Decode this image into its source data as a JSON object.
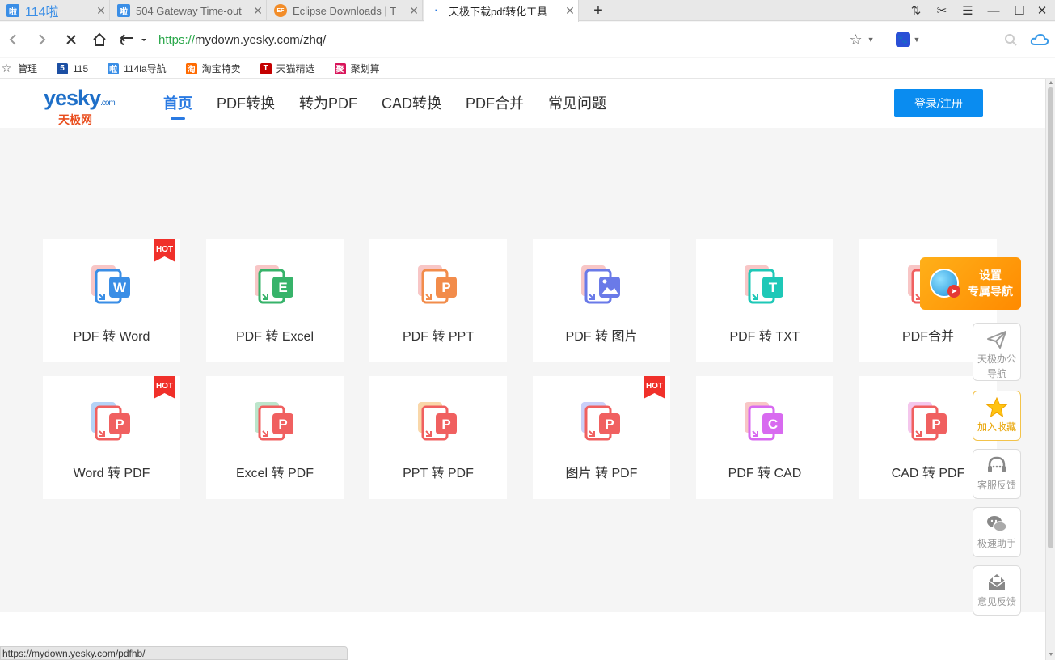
{
  "browser": {
    "tabs": [
      {
        "title": "114啦",
        "icon_text": "啦",
        "icon_color": "#3a8ee6"
      },
      {
        "title": "504 Gateway Time-out",
        "icon_text": "啦",
        "icon_color": "#3a8ee6"
      },
      {
        "title": "Eclipse Downloads | T",
        "icon_text": "EF",
        "icon_color": "#f28c28"
      },
      {
        "title": "天极下载pdf转化工具",
        "icon_text": "·",
        "icon_color": "#2a7ae2",
        "active": true
      }
    ],
    "new_tab": "+",
    "url_scheme": "https://",
    "url_rest": "mydown.yesky.com/zhq/",
    "bookmarks": [
      {
        "label": "管理",
        "icon": "star-outline",
        "icon_color": "#666"
      },
      {
        "label": "115",
        "icon_text": "5",
        "icon_color": "#1c4fa3"
      },
      {
        "label": "114la导航",
        "icon_text": "啦",
        "icon_color": "#3a8ee6"
      },
      {
        "label": "淘宝特卖",
        "icon_text": "淘",
        "icon_color": "#ff6a00"
      },
      {
        "label": "天猫精选",
        "icon_text": "T",
        "icon_color": "#c40000"
      },
      {
        "label": "聚划算",
        "icon_text": "聚",
        "icon_color": "#d8145a"
      }
    ],
    "status_url": "https://mydown.yesky.com/pdfhb/"
  },
  "site": {
    "logo_top": "yesky",
    "logo_com": ".com",
    "logo_bottom": "天极网",
    "nav": [
      "首页",
      "PDF转换",
      "转为PDF",
      "CAD转换",
      "PDF合并",
      "常见问题"
    ],
    "login": "登录/注册",
    "hot_badge": "HOT"
  },
  "tools": [
    {
      "label": "PDF 转 Word",
      "letter": "W",
      "color": "#3a8ee6",
      "back": "#f6b3b3",
      "hot": true
    },
    {
      "label": "PDF 转 Excel",
      "letter": "E",
      "color": "#37b36a",
      "back": "#f6b3b3",
      "hot": false
    },
    {
      "label": "PDF 转 PPT",
      "letter": "P",
      "color": "#f28c4b",
      "back": "#f6b3b3",
      "hot": false
    },
    {
      "label": "PDF 转 图片",
      "letter": "img",
      "color": "#6a7ae8",
      "back": "#f6b3b3",
      "hot": false
    },
    {
      "label": "PDF 转 TXT",
      "letter": "T",
      "color": "#1ec8b7",
      "back": "#f6b3b3",
      "hot": false
    },
    {
      "label": "PDF合并",
      "letter": "P",
      "color": "#f06060",
      "back": "#f6b3b3",
      "hot": false
    },
    {
      "label": "Word 转 PDF",
      "letter": "P",
      "color": "#f06060",
      "back": "#9cc3f3",
      "hot": true
    },
    {
      "label": "Excel 转 PDF",
      "letter": "P",
      "color": "#f06060",
      "back": "#a6dcb9",
      "hot": false
    },
    {
      "label": "PPT 转 PDF",
      "letter": "P",
      "color": "#f06060",
      "back": "#f7c98c",
      "hot": false
    },
    {
      "label": "图片 转 PDF",
      "letter": "P",
      "color": "#f06060",
      "back": "#b8bff5",
      "hot": true
    },
    {
      "label": "PDF 转 CAD",
      "letter": "C",
      "color": "#d86af0",
      "back": "#f6b3b3",
      "hot": false
    },
    {
      "label": "CAD 转 PDF",
      "letter": "P",
      "color": "#f06060",
      "back": "#f0b3e6",
      "hot": false
    }
  ],
  "side": {
    "promo_line1": "设置",
    "promo_line2": "专属导航",
    "buttons": [
      {
        "line1": "天极办公",
        "line2": "导航",
        "icon": "paper-plane-icon"
      },
      {
        "line1": "加入收藏",
        "line2": "",
        "icon": "star-icon",
        "highlight": true
      },
      {
        "line1": "客服反馈",
        "line2": "",
        "icon": "headset-icon"
      },
      {
        "line1": "极速助手",
        "line2": "",
        "icon": "wechat-icon"
      },
      {
        "line1": "意见反馈",
        "line2": "",
        "icon": "mail-icon"
      }
    ]
  }
}
